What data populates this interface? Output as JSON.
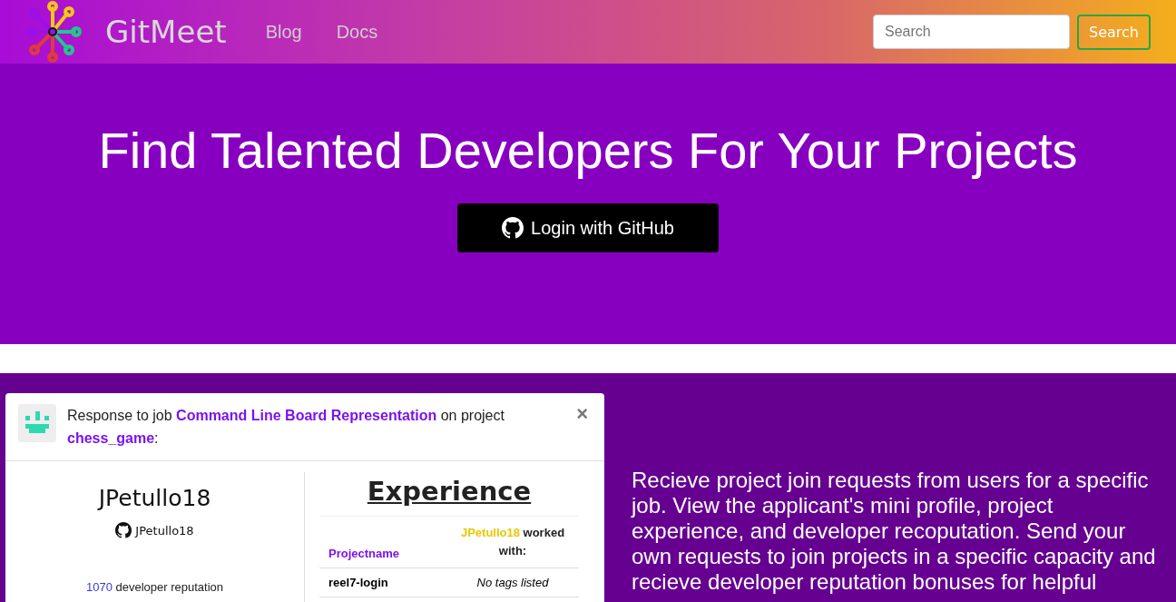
{
  "navbar": {
    "brand": "GitMeet",
    "links": [
      {
        "label": "Blog"
      },
      {
        "label": "Docs"
      }
    ],
    "search": {
      "placeholder": "Search",
      "button": "Search"
    }
  },
  "hero": {
    "title": "Find Talented Developers For Your Projects",
    "login_button": "Login with GitHub"
  },
  "feature": {
    "screenshot": {
      "header": {
        "prefix": "Response to job ",
        "job": "Command Line Board Representation",
        "middle": " on project ",
        "project": "chess_game",
        "suffix": ":",
        "close": "×"
      },
      "profile": {
        "name": "JPetullo18",
        "github_user": "JPetullo18",
        "reputation_value": "1070",
        "reputation_label": " developer reputation"
      },
      "experience": {
        "title": "Experience",
        "columns": [
          {
            "label": "Projectname"
          },
          {
            "user": "JPetullo18",
            "label": " worked with:"
          }
        ],
        "rows": [
          {
            "project": "reel7-login",
            "tags": "No tags listed"
          }
        ]
      }
    },
    "description": "Recieve project join requests from users for a specific job. View the applicant's mini profile, project experience, and developer recoputation. Send your own requests to join projects in a specific capacity and recieve developer reputation bonuses for helpful"
  }
}
